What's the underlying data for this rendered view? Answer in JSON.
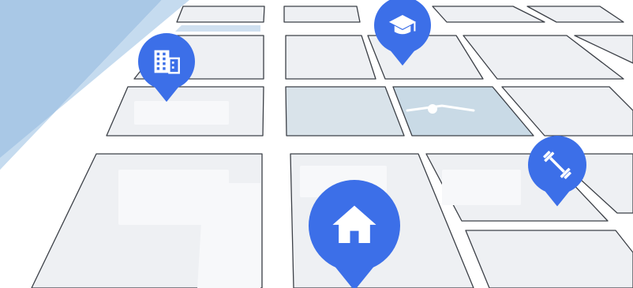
{
  "map": {
    "colors": {
      "background": "#ffffff",
      "water": "#a9c8e6",
      "water_light": "#c5dbef",
      "road": "#ffffff",
      "block_fill": "#eef0f3",
      "block_stroke": "#3c4047",
      "block_park": "#d9e3ea",
      "pin": "#3c6fe8",
      "pin_icon": "#ffffff"
    },
    "pins": [
      {
        "name": "school-pin",
        "icon": "graduation-cap-icon"
      },
      {
        "name": "office-pin",
        "icon": "office-building-icon"
      },
      {
        "name": "gym-pin",
        "icon": "dumbbell-icon"
      },
      {
        "name": "home-pin",
        "icon": "home-icon"
      }
    ]
  }
}
